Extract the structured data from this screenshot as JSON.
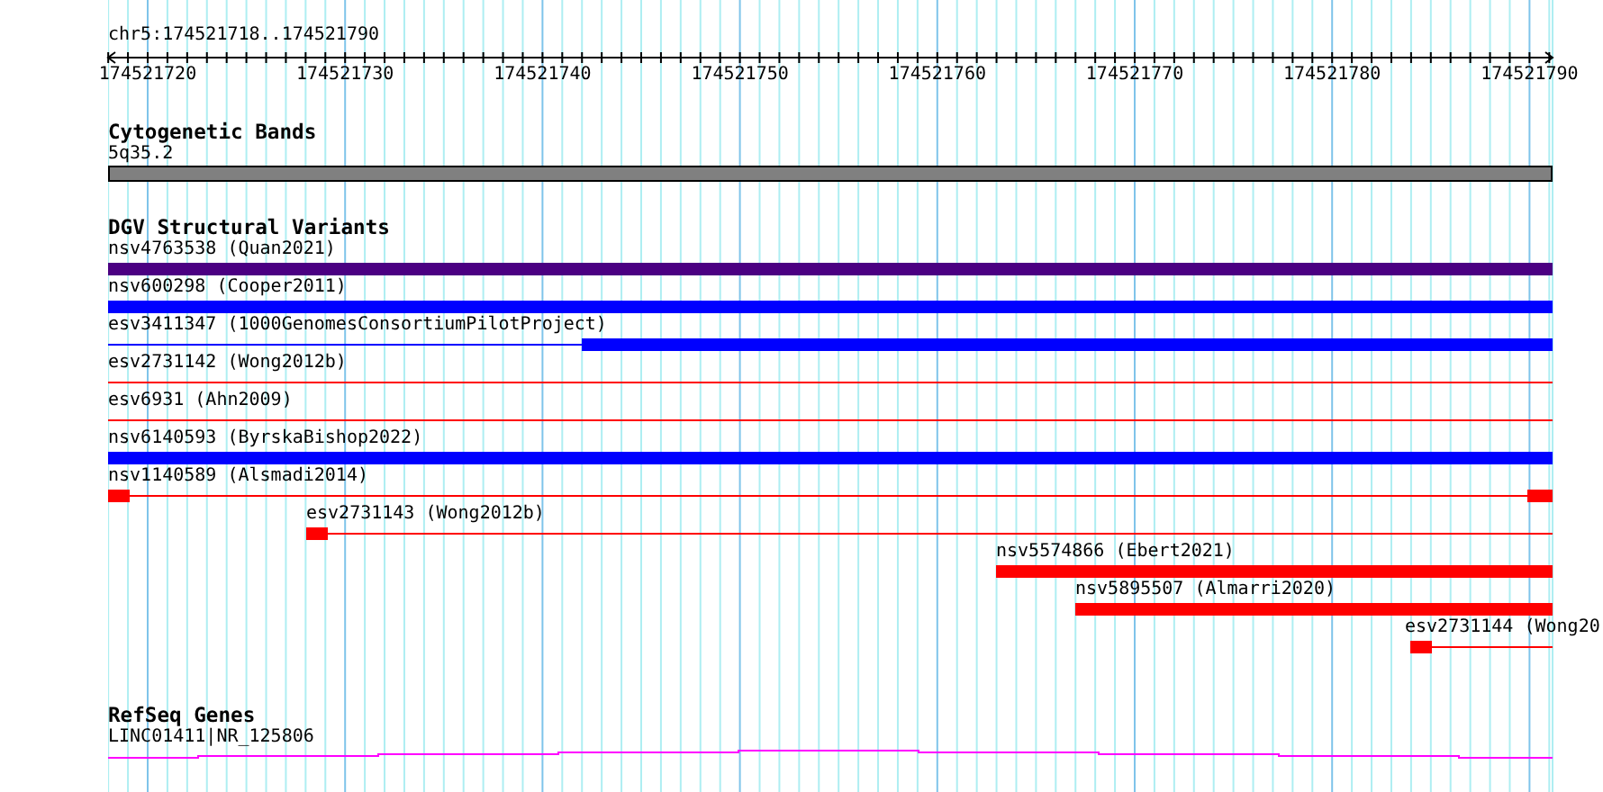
{
  "ruler": {
    "region": "chr5:174521718..174521790",
    "labels": [
      "174521720",
      "174521730",
      "174521740",
      "174521750",
      "174521760",
      "174521770",
      "174521780",
      "174521790"
    ]
  },
  "cytobands": {
    "title": "Cytogenetic Bands",
    "label": "5q35.2"
  },
  "variants": {
    "title": "DGV Structural Variants",
    "features": [
      {
        "label": "nsv4763538 (Quan2021)",
        "color": "#4b0082"
      },
      {
        "label": "nsv600298 (Cooper2011)",
        "color": "#0000ff"
      },
      {
        "label": "esv3411347 (1000GenomesConsortiumPilotProject)",
        "color": "#0000ff"
      },
      {
        "label": "esv2731142 (Wong2012b)",
        "color": "#ff0000"
      },
      {
        "label": "esv6931 (Ahn2009)",
        "color": "#ff0000"
      },
      {
        "label": "nsv6140593 (ByrskaBishop2022)",
        "color": "#0000ff"
      },
      {
        "label": "nsv1140589 (Alsmadi2014)",
        "color": "#ff0000"
      },
      {
        "label": "esv2731143 (Wong2012b)",
        "color": "#ff0000"
      },
      {
        "label": "nsv5574866 (Ebert2021)",
        "color": "#ff0000"
      },
      {
        "label": "nsv5895507 (Almarri2020)",
        "color": "#ff0000"
      },
      {
        "label": "esv2731144 (Wong20",
        "color": "#ff0000"
      }
    ]
  },
  "genes": {
    "title": "RefSeq Genes",
    "label": "LINC01411|NR_125806"
  }
}
